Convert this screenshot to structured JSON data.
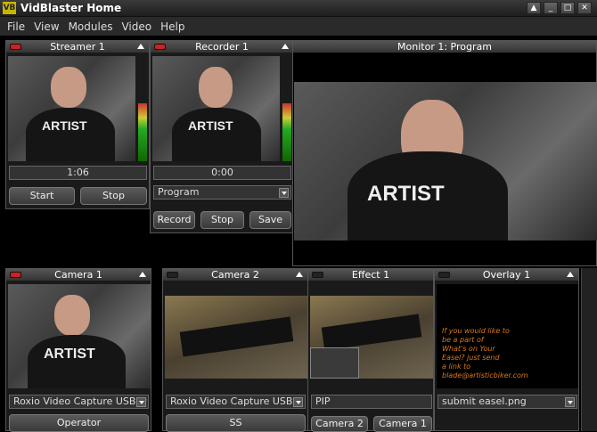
{
  "window": {
    "title": "VidBlaster Home",
    "icon": "VB"
  },
  "menu": [
    "File",
    "View",
    "Modules",
    "Video",
    "Help"
  ],
  "streamer": {
    "title": "Streamer 1",
    "time": "1:06",
    "start": "Start",
    "stop": "Stop",
    "shirt_text": "ARTIST"
  },
  "recorder": {
    "title": "Recorder 1",
    "time": "0:00",
    "source": "Program",
    "record": "Record",
    "stop": "Stop",
    "save": "Save",
    "shirt_text": "ARTIST"
  },
  "monitor": {
    "title": "Monitor 1: Program",
    "shirt_text": "ARTIST"
  },
  "camera1": {
    "title": "Camera 1",
    "device": "Roxio Video Capture USB #",
    "button": "Operator",
    "shirt_text": "ARTIST"
  },
  "camera2": {
    "title": "Camera 2",
    "device": "Roxio Video Capture USB",
    "button": "SS"
  },
  "effect1": {
    "title": "Effect 1",
    "mode": "PIP",
    "btn_a": "Camera 2",
    "btn_b": "Camera 1"
  },
  "overlay1": {
    "title": "Overlay 1",
    "lines": [
      "If you would like to",
      "be a part of",
      "What's on Your",
      "Easel? just send",
      "a link to",
      "blade@artisticbiker.com"
    ],
    "file": "submit easel.png"
  },
  "colors": {
    "led_on": "#d02020",
    "overlay_text": "#d8781c"
  }
}
